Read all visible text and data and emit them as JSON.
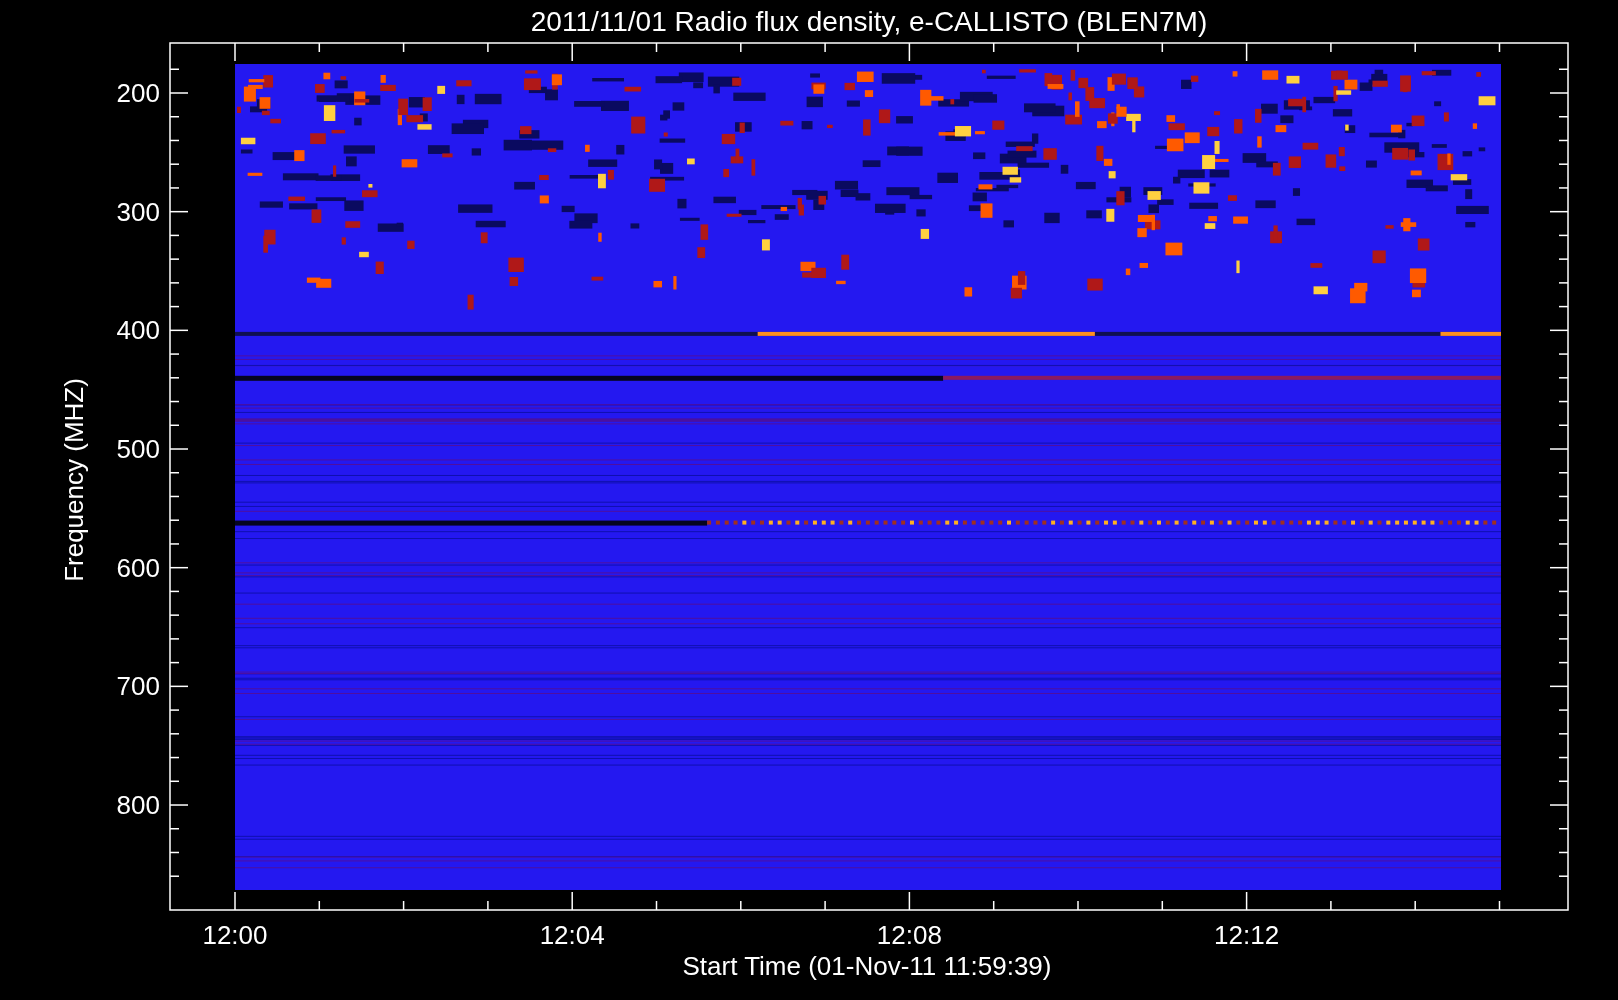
{
  "title": "2011/11/01  Radio flux density, e-CALLISTO (BLEN7M)",
  "xlabel": "Start Time (01-Nov-11 11:59:39)",
  "ylabel": "Frequency (MHZ)",
  "xticks": [
    "12:00",
    "12:04",
    "12:08",
    "12:12"
  ],
  "yticks": [
    "200",
    "300",
    "400",
    "500",
    "600",
    "700",
    "800"
  ]
}
